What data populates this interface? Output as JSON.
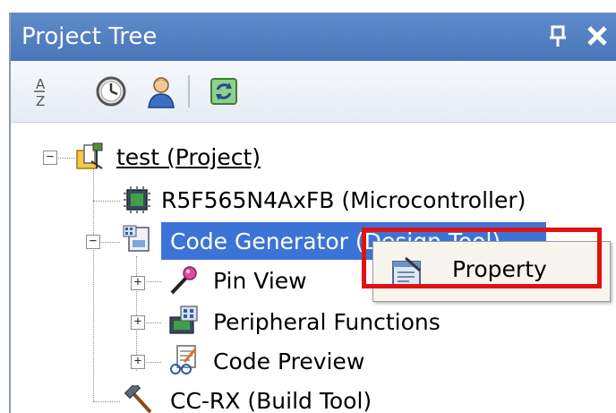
{
  "panel": {
    "title": "Project Tree",
    "pin_glyph": "ᕑ",
    "close_glyph": "✕"
  },
  "toolbar": {
    "buttons": [
      {
        "name": "sort-az-icon"
      },
      {
        "name": "clock-icon"
      },
      {
        "name": "user-icon"
      },
      {
        "name": "refresh-icon"
      }
    ],
    "sort_label_top": "A",
    "sort_label_bottom": "Z"
  },
  "tree": {
    "project": "test (Project)",
    "microcontroller": "R5F565N4AxFB (Microcontroller)",
    "code_generator": "Code Generator (Design Tool)",
    "pin_view": "Pin View",
    "peripheral_functions": "Peripheral Functions",
    "code_preview": "Code Preview",
    "build_tool": "CC-RX (Build Tool)"
  },
  "context_menu": {
    "items": [
      {
        "label": "Property",
        "icon": "property-icon"
      }
    ]
  },
  "colors": {
    "titlebar": "#4f7ec0",
    "selection": "#3b74d6",
    "highlight": "#e01212"
  }
}
